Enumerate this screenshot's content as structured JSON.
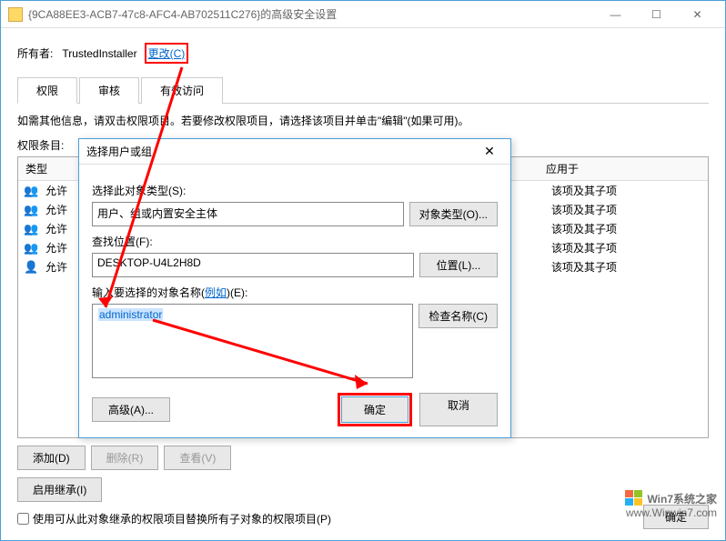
{
  "window": {
    "title": "{9CA88EE3-ACB7-47c8-AFC4-AB702511C276}的高级安全设置",
    "minimize": "—",
    "maximize": "☐",
    "close": "✕"
  },
  "owner": {
    "label": "所有者:",
    "value": "TrustedInstaller",
    "change_link": "更改(C)"
  },
  "tabs": {
    "permissions": "权限",
    "audit": "审核",
    "effective": "有效访问"
  },
  "info_text": "如需其他信息，请双击权限项目。若要修改权限项目，请选择该项目并单击\"编辑\"(如果可用)。",
  "perm_section_label": "权限条目:",
  "perm_headers": {
    "type": "类型",
    "applies": "应用于"
  },
  "perm_rows": [
    {
      "type": "允许",
      "applies": "该项及其子项",
      "icon": "users"
    },
    {
      "type": "允许",
      "applies": "该项及其子项",
      "icon": "users"
    },
    {
      "type": "允许",
      "applies": "该项及其子项",
      "icon": "users"
    },
    {
      "type": "允许",
      "applies": "该项及其子项",
      "icon": "users"
    },
    {
      "type": "允许",
      "applies": "该项及其子项",
      "icon": "user"
    }
  ],
  "buttons": {
    "add": "添加(D)",
    "remove": "删除(R)",
    "view": "查看(V)",
    "enable_inherit": "启用继承(I)",
    "ok": "确定"
  },
  "checkbox_text": "使用可从此对象继承的权限项目替换所有子对象的权限项目(P)",
  "dialog": {
    "title": "选择用户或组",
    "close": "✕",
    "object_type_label": "选择此对象类型(S):",
    "object_type_value": "用户、组或内置安全主体",
    "object_type_btn": "对象类型(O)...",
    "location_label": "查找位置(F):",
    "location_value": "DESKTOP-U4L2H8D",
    "location_btn": "位置(L)...",
    "names_label_prefix": "输入要选择的对象名称(",
    "names_label_link": "例如",
    "names_label_suffix": ")(E):",
    "names_value": "administrator",
    "check_btn": "检查名称(C)",
    "advanced_btn": "高级(A)...",
    "ok_btn": "确定",
    "cancel_btn": "取消"
  },
  "watermark": {
    "line1": "Win7系统之家",
    "line2": "www.Winwin7.com"
  }
}
